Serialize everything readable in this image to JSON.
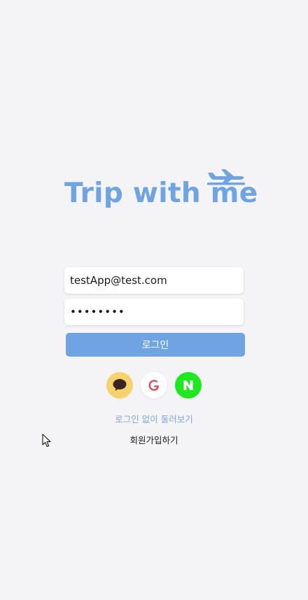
{
  "brand": {
    "title": "Trip with me",
    "logo_color": "#6fa4e3",
    "icon": "airplane-icon"
  },
  "login_form": {
    "email_value": "testApp@test.com",
    "password_value": "password",
    "login_label": "로그인"
  },
  "social_login": [
    {
      "name": "kakao",
      "icon": "kakao-speech-bubble-icon",
      "color": "#f5d26e"
    },
    {
      "name": "google",
      "icon": "google-g-icon",
      "color": "#ffffff"
    },
    {
      "name": "naver",
      "icon": "naver-n-icon",
      "color": "#1ee81e"
    }
  ],
  "links": {
    "guest_label": "로그인 없이 둘러보기",
    "signup_label": "회원가입하기"
  },
  "colors": {
    "background": "#f4f4f6",
    "accent": "#6fa4e3",
    "guest_link": "#7ea8d8"
  }
}
